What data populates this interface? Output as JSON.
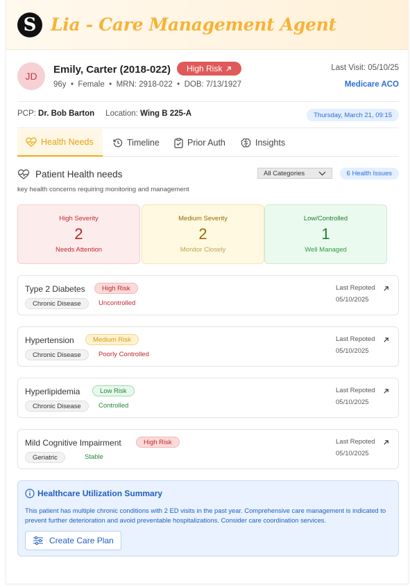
{
  "app": {
    "logo_letter": "S",
    "title": "Lia - Care Management Agent",
    "accent": "#f6b33a"
  },
  "patient": {
    "initials": "JD",
    "name": "Emily, Carter (2018-022)",
    "risk_label": "High Risk",
    "age": "96y",
    "sex": "Female",
    "mrn": "MRN: 2918-022",
    "dob": "DOB: 7/13/1927",
    "last_visit": "Last Visit: 05/10/25",
    "insurance": "Medicare ACO",
    "pcp_label": "PCP:",
    "pcp": "Dr. Bob Barton",
    "location_label": "Location:",
    "location": "Wing B 225-A",
    "datetime": "Thursday, March 21, 09:15"
  },
  "tabs": [
    {
      "label": "Health Needs",
      "icon": "heart-pulse-icon",
      "active": true
    },
    {
      "label": "Timeline",
      "icon": "history-icon",
      "active": false
    },
    {
      "label": "Prior Auth",
      "icon": "clipboard-check-icon",
      "active": false
    },
    {
      "label": "Insights",
      "icon": "brain-icon",
      "active": false
    }
  ],
  "health_needs": {
    "title": "Patient Health needs",
    "subtitle": "key health concerns requiring monitoring and management",
    "category_filter": "All Categories",
    "issue_count": "6 Health Issues",
    "severity": [
      {
        "label": "High Severity",
        "count": "2",
        "note": "Needs Attention"
      },
      {
        "label": "Medium Severity",
        "count": "2",
        "note": "Monitor Closely"
      },
      {
        "label": "Low/Controlled",
        "count": "1",
        "note": "Well Managed"
      }
    ],
    "conditions": [
      {
        "name": "Type 2 Diabetes",
        "risk": "High Risk",
        "type": "Chronic Disease",
        "status": "Uncontrolled",
        "reported_label": "Last Repoted",
        "reported_date": "05/10/2025"
      },
      {
        "name": "Hypertension",
        "risk": "Medium Risk",
        "type": "Chronic Disease",
        "status": "Poorly Controlled",
        "reported_label": "Last Repoted",
        "reported_date": "05/10/2025"
      },
      {
        "name": "Hyperlipidemia",
        "risk": "Low Risk",
        "type": "Chronic Disease",
        "status": "Controlled",
        "reported_label": "Last Repoted",
        "reported_date": "05/10/2025"
      },
      {
        "name": "Mild Cognitive Impairment",
        "risk": "High Risk",
        "type": "Geriatric",
        "status": "Stable",
        "reported_label": "Last Repoted",
        "reported_date": "05/10/2025"
      }
    ]
  },
  "summary": {
    "title": "Healthcare Utilization Summary",
    "text": "This patient has multiple chronic conditions with 2 ED visits in the past year. Comprehensive care management is indicated to prevent further deterioration and avoid preventable hospitalizations. Consider care coordination services.",
    "button": "Create Care Plan"
  }
}
